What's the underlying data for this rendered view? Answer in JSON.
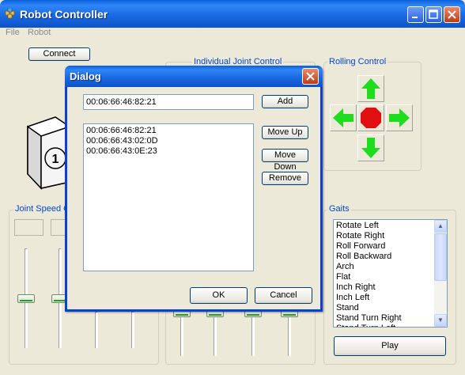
{
  "window": {
    "title": "Robot Controller",
    "menu": [
      "File",
      "Robot"
    ]
  },
  "main": {
    "connect_label": "Connect",
    "joint_group_label": "Individual Joint Control",
    "rolling_group_label": "Rolling Control",
    "joint_speed_label": "Joint Speed C",
    "gaits_label": "Gaits",
    "play_label": "Play",
    "cube_face_label": "1",
    "gaits": [
      "Rotate Left",
      "Rotate Right",
      "Roll Forward",
      "Roll Backward",
      "Arch",
      "Flat",
      "Inch Right",
      "Inch Left",
      "Stand",
      "Stand Turn Right",
      "Stand Turn Left"
    ],
    "slider_levels": [
      0.35,
      0.35
    ]
  },
  "dialog": {
    "title": "Dialog",
    "address_value": "00:06:66:46:82:21",
    "add_label": "Add",
    "devices": [
      "00:06:66:46:82:21",
      "00:06:66:43:02:0D",
      "00:06:66:43:0E:23"
    ],
    "move_up_label": "Move Up",
    "move_down_label": "Move Down",
    "remove_label": "Remove",
    "ok_label": "OK",
    "cancel_label": "Cancel"
  },
  "colors": {
    "arrow": "#1fdc1f",
    "stop": "#e01010",
    "titlebar": "#0a5fd9"
  }
}
